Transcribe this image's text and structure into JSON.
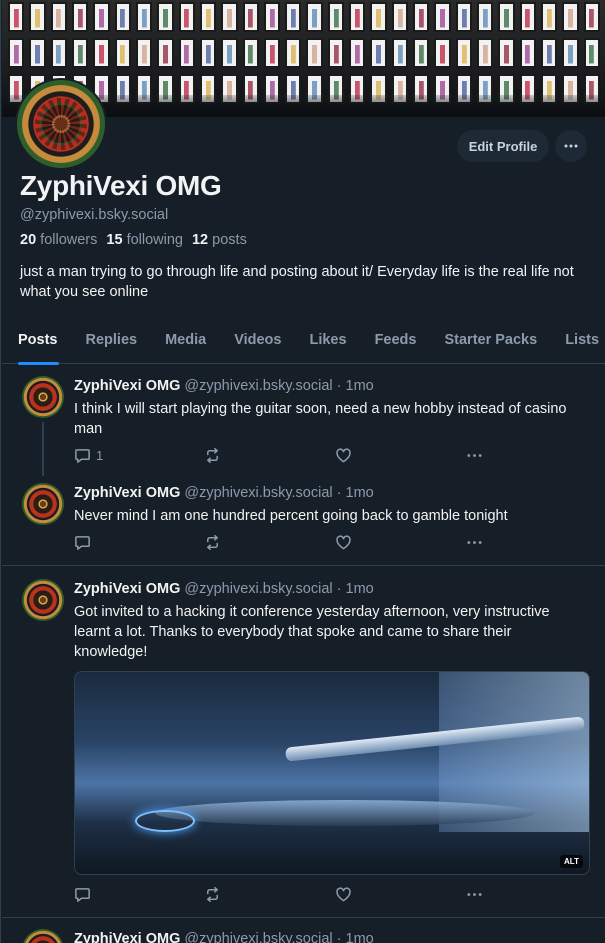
{
  "profile": {
    "display_name": "ZyphiVexi OMG",
    "handle": "@zyphivexi.bsky.social",
    "followers_count": "20",
    "followers_label": "followers",
    "following_count": "15",
    "following_label": "following",
    "posts_count": "12",
    "posts_label": "posts",
    "bio": "just a man trying to go through life and posting about it/ Everyday life is the real life not what you see online",
    "edit_label": "Edit Profile"
  },
  "tabs": [
    {
      "label": "Posts",
      "active": true
    },
    {
      "label": "Replies"
    },
    {
      "label": "Media"
    },
    {
      "label": "Videos"
    },
    {
      "label": "Likes"
    },
    {
      "label": "Feeds"
    },
    {
      "label": "Starter Packs"
    },
    {
      "label": "Lists"
    }
  ],
  "posts": [
    {
      "author": "ZyphiVexi OMG",
      "handle": "@zyphivexi.bsky.social",
      "time": "· 1mo",
      "text": "I think I will start playing the guitar soon, need a new hobby instead of casino man",
      "reply_count": "1"
    },
    {
      "author": "ZyphiVexi OMG",
      "handle": "@zyphivexi.bsky.social",
      "time": "· 1mo",
      "text": "Never mind I am one hundred percent going back to gamble tonight",
      "reply_count": ""
    },
    {
      "author": "ZyphiVexi OMG",
      "handle": "@zyphivexi.bsky.social",
      "time": "· 1mo",
      "text": "Got invited to a hacking it conference yesterday afternoon, very instructive learnt a lot. Thanks to everybody that spoke and came to share their knowledge!",
      "reply_count": "",
      "media_alt_badge": "ALT"
    },
    {
      "author": "ZyphiVexi OMG",
      "handle": "@zyphivexi.bsky.social",
      "time": "· 1mo"
    }
  ],
  "icons": {
    "reply": "speech-bubble-icon",
    "repost": "repost-arrows-icon",
    "like": "heart-icon",
    "more": "ellipsis-icon"
  },
  "colors": {
    "background": "#161e27",
    "accent": "#208bfe",
    "muted_text": "#8c9aab",
    "border": "#2e4052"
  }
}
